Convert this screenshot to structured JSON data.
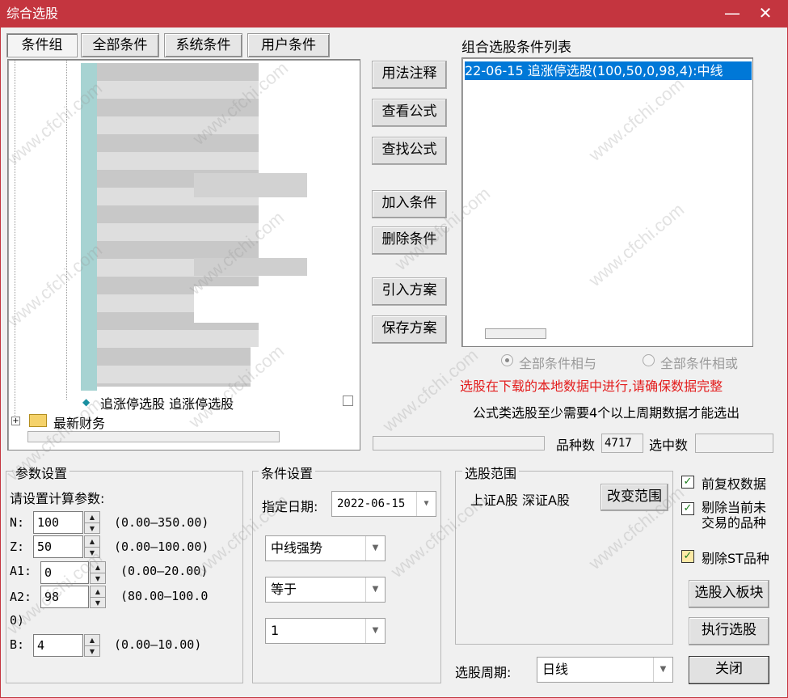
{
  "window": {
    "title": "综合选股",
    "minimize": "—",
    "close": "✕"
  },
  "tabs": [
    "条件组",
    "全部条件",
    "系统条件",
    "用户条件"
  ],
  "tree": {
    "selected_item": "追涨停选股 追涨停选股",
    "folder_item": "最新财务",
    "expand_glyph": "+"
  },
  "middle_buttons": {
    "usage": "用法注释",
    "view": "查看公式",
    "find": "查找公式",
    "add": "加入条件",
    "delete": "删除条件",
    "import": "引入方案",
    "save": "保存方案"
  },
  "condition_list": {
    "title": "组合选股条件列表",
    "items": [
      "22-06-15 追涨停选股(100,50,0,98,4):中线"
    ]
  },
  "logic": {
    "and_label": "全部条件相与",
    "or_label": "全部条件相或"
  },
  "notes": {
    "warning": "选股在下载的本地数据中进行,请确保数据完整",
    "info": "公式类选股至少需要4个以上周期数据才能选出"
  },
  "counts": {
    "total_label": "品种数",
    "total_value": "4717",
    "selected_label": "选中数",
    "selected_value": ""
  },
  "params": {
    "legend": "参数设置",
    "prompt": "请设置计算参数:",
    "rows": [
      {
        "name": "N:",
        "value": "100",
        "range": "(0.00—350.00)"
      },
      {
        "name": "Z:",
        "value": "50",
        "range": "(0.00—100.00)"
      },
      {
        "name": "A1:",
        "value": "0",
        "range": "(0.00—20.00)"
      },
      {
        "name": "A2:",
        "value": "98",
        "range": "(80.00—100.0"
      },
      {
        "name": "B:",
        "value": "4",
        "range": "(0.00—10.00)"
      }
    ],
    "wrap": "0)"
  },
  "cond_settings": {
    "legend": "条件设置",
    "date_label": "指定日期:",
    "date_value": "2022-06-15",
    "combo1": "中线强势",
    "combo2": "等于",
    "combo3": "1"
  },
  "scope": {
    "legend": "选股范围",
    "text": "上证A股 深证A股",
    "change_button": "改变范围"
  },
  "options": {
    "forward_adjust": "前复权数据",
    "exclude_untraded": "剔除当前未交易的品种",
    "exclude_st": "剔除ST品种"
  },
  "actions": {
    "to_block": "选股入板块",
    "run": "执行选股",
    "close": "关闭"
  },
  "period": {
    "label": "选股周期:",
    "value": "日线"
  },
  "watermark": "www.cfchi.com",
  "colors": {
    "title_bar": "#c4353f",
    "selection": "#0078d7",
    "warning": "#e31c1c"
  }
}
